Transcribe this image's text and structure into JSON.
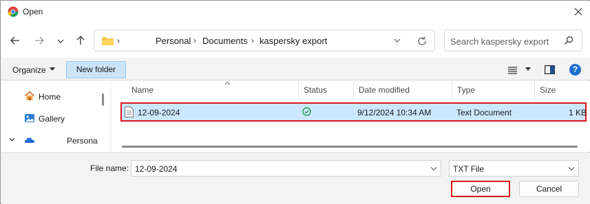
{
  "window": {
    "title": "Open"
  },
  "nav": {
    "breadcrumbs": [
      "Personal",
      "Documents",
      "kaspersky export"
    ],
    "search_placeholder": "Search kaspersky export"
  },
  "toolbar": {
    "organize_label": "Organize",
    "new_folder_label": "New folder",
    "help_label": "?"
  },
  "sidebar": {
    "items": [
      {
        "label": "Home",
        "icon": "home-icon"
      },
      {
        "label": "Gallery",
        "icon": "gallery-icon"
      },
      {
        "label": "Persona",
        "icon": "onedrive-icon"
      }
    ]
  },
  "filelist": {
    "columns": [
      "Name",
      "Status",
      "Date modified",
      "Type",
      "Size"
    ],
    "rows": [
      {
        "name": "12-09-2024",
        "status_icon": "synced-check-icon",
        "date_modified": "9/12/2024 10:34 AM",
        "type": "Text Document",
        "size": "1 KB"
      }
    ]
  },
  "bottom": {
    "file_name_label": "File name:",
    "file_name_value": "12-09-2024",
    "file_type_value": "TXT File",
    "open_label": "Open",
    "cancel_label": "Cancel"
  },
  "colors": {
    "selection": "#cce8ff",
    "highlight_border": "#e0141a",
    "accent": "#1f6fd1"
  }
}
